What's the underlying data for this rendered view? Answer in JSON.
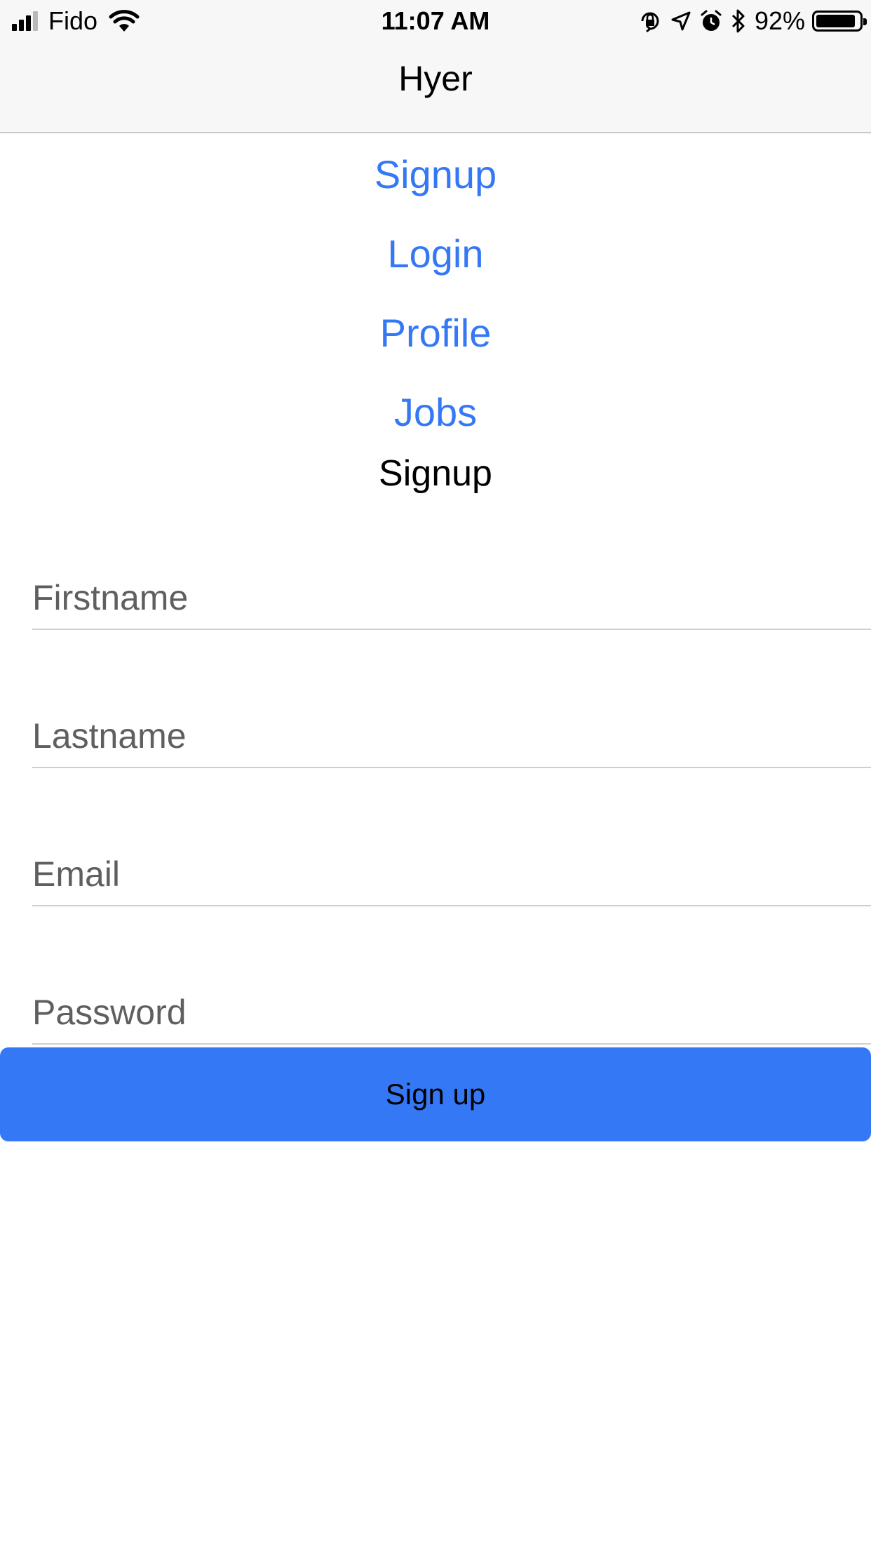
{
  "status_bar": {
    "carrier": "Fido",
    "time": "11:07 AM",
    "battery_percent": "92%",
    "battery_level": 0.92,
    "signal_bars_filled": 3,
    "signal_bars_total": 4,
    "icons": [
      "signal-icon",
      "wifi-icon",
      "orientation-lock-icon",
      "location-icon",
      "alarm-icon",
      "bluetooth-icon",
      "battery-icon"
    ]
  },
  "nav": {
    "title": "Hyer"
  },
  "links": [
    {
      "label": "Signup"
    },
    {
      "label": "Login"
    },
    {
      "label": "Profile"
    },
    {
      "label": "Jobs"
    }
  ],
  "form": {
    "title": "Signup",
    "firstname": {
      "placeholder": "Firstname",
      "value": ""
    },
    "lastname": {
      "placeholder": "Lastname",
      "value": ""
    },
    "email": {
      "placeholder": "Email",
      "value": ""
    },
    "password": {
      "placeholder": "Password",
      "value": ""
    },
    "submit_label": "Sign up"
  },
  "colors": {
    "accent": "#3478f6",
    "link": "#3478f6",
    "bar_background": "#f7f7f7"
  }
}
